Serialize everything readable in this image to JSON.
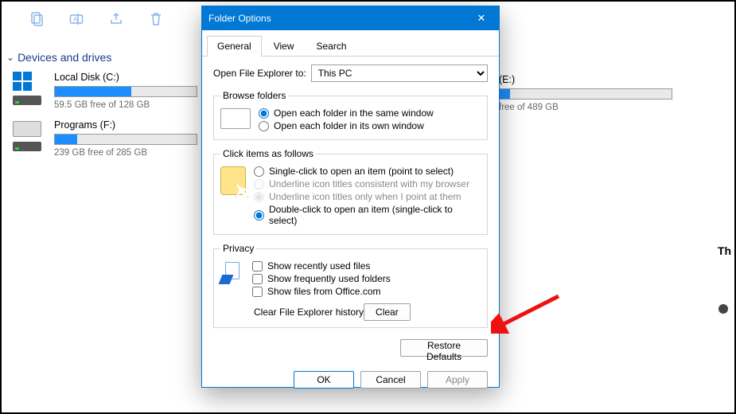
{
  "toolbar_icons": [
    "copy",
    "rename",
    "share",
    "delete"
  ],
  "section_header": "Devices and drives",
  "drives": [
    {
      "name": "Local Disk (C:)",
      "free": "59.5 GB free of 128 GB",
      "fill_pct": 54
    },
    {
      "name": "Programs (F:)",
      "free": "239 GB free of 285 GB",
      "fill_pct": 16
    }
  ],
  "right_drive": {
    "label": "(E:)",
    "free": "free of 489 GB",
    "fill_pct": 6
  },
  "dialog": {
    "title": "Folder Options",
    "tabs": [
      "General",
      "View",
      "Search"
    ],
    "active_tab": 0,
    "open_label": "Open File Explorer to:",
    "open_value": "This PC",
    "browse": {
      "legend": "Browse folders",
      "same": "Open each folder in the same window",
      "own": "Open each folder in its own window",
      "selected": "same"
    },
    "click": {
      "legend": "Click items as follows",
      "single": "Single-click to open an item (point to select)",
      "underline_browser": "Underline icon titles consistent with my browser",
      "underline_point": "Underline icon titles only when I point at them",
      "double": "Double-click to open an item (single-click to select)",
      "selected": "double"
    },
    "privacy": {
      "legend": "Privacy",
      "recent": "Show recently used files",
      "frequent": "Show frequently used folders",
      "office": "Show files from Office.com",
      "clear_label": "Clear File Explorer history",
      "clear_btn": "Clear"
    },
    "restore_btn": "Restore Defaults",
    "ok": "OK",
    "cancel": "Cancel",
    "apply": "Apply"
  },
  "right_text": "Th"
}
